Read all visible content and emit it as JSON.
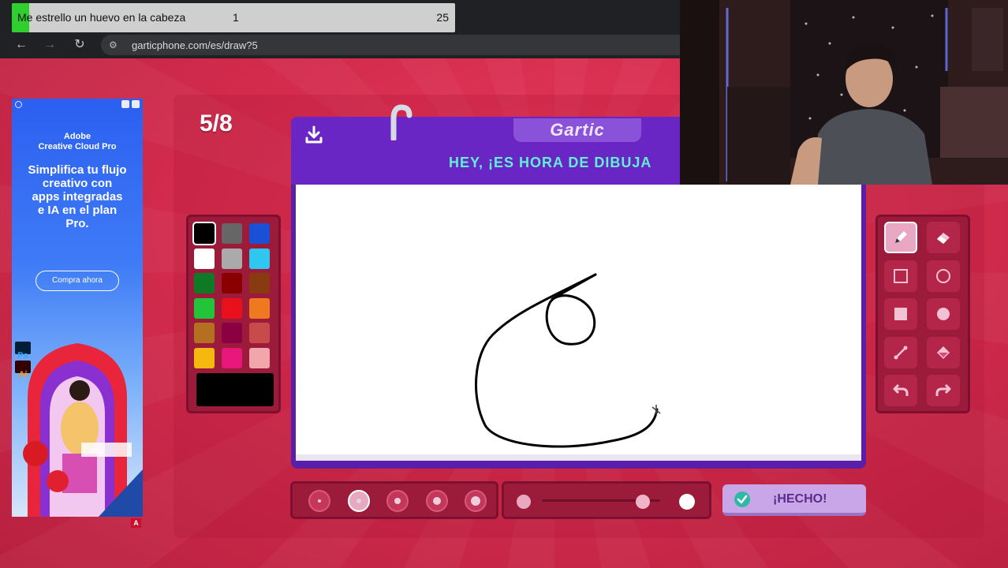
{
  "browser": {
    "tab_title": "Me estrello un huevo en la cabeza",
    "tab_count_a": "1",
    "tab_count_b": "25",
    "url": "garticphone.com/es/draw?5",
    "nav": {
      "back_icon": "arrow-left-icon",
      "forward_icon": "arrow-right-icon",
      "reload_icon": "reload-icon",
      "site_info_icon": "tune-icon"
    }
  },
  "ad": {
    "brand": "Adobe\nCreative Cloud Pro",
    "brand_line1": "Adobe",
    "brand_line2": "Creative Cloud Pro",
    "headline": "Simplifica tu flujo creativo con apps integradas e IA en el plan Pro.",
    "cta": "Compra ahora",
    "badge_ps": "Ps",
    "badge_ai": "Ai",
    "corner": "A"
  },
  "game": {
    "round": "5/8",
    "logo": "Gartic",
    "banner": "HEY, ¡ES HORA DE DIBUJA",
    "done_label": "¡HECHO!",
    "selected_color": "#000000",
    "palette": [
      "#000000",
      "#666666",
      "#1a50d6",
      "#ffffff",
      "#aaaaaa",
      "#2fc7f0",
      "#0f7a25",
      "#8a0000",
      "#8a3a10",
      "#22c43a",
      "#e8101a",
      "#f07820",
      "#b47020",
      "#8a0040",
      "#c84a4a",
      "#f5b80e",
      "#e8157a",
      "#f0a6aa"
    ],
    "tools": [
      {
        "name": "pencil-tool",
        "icon": "pencil-icon",
        "active": true
      },
      {
        "name": "eraser-tool",
        "icon": "eraser-icon",
        "active": false
      },
      {
        "name": "rectangle-outline-tool",
        "icon": "square-outline-icon",
        "active": false
      },
      {
        "name": "ellipse-outline-tool",
        "icon": "circle-outline-icon",
        "active": false
      },
      {
        "name": "rectangle-fill-tool",
        "icon": "square-fill-icon",
        "active": false
      },
      {
        "name": "ellipse-fill-tool",
        "icon": "circle-fill-icon",
        "active": false
      },
      {
        "name": "line-tool",
        "icon": "line-icon",
        "active": false
      },
      {
        "name": "fill-tool",
        "icon": "paint-bucket-icon",
        "active": false
      },
      {
        "name": "undo-tool",
        "icon": "undo-icon",
        "active": false
      },
      {
        "name": "redo-tool",
        "icon": "redo-icon",
        "active": false
      }
    ],
    "brush_sizes": 5,
    "selected_size_index": 1,
    "opacity_level": 0.85
  }
}
